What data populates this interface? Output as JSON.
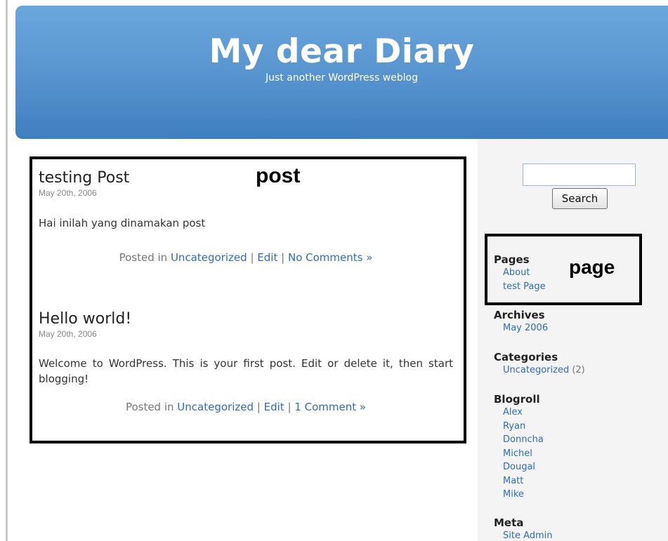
{
  "header": {
    "title": "My dear Diary",
    "tagline": "Just another WordPress weblog"
  },
  "annotations": {
    "post_label": "post",
    "page_label": "page"
  },
  "posts": [
    {
      "title": "testing Post",
      "date": "May 20th, 2006",
      "body": "Hai inilah yang dinamakan post",
      "posted_in": "Posted in",
      "category": "Uncategorized",
      "sep1": "|",
      "edit": "Edit",
      "sep2": "|",
      "comments": "No Comments »"
    },
    {
      "title": "Hello world!",
      "date": "May 20th, 2006",
      "body": "Welcome to WordPress. This is your first post. Edit or delete it, then start blogging!",
      "posted_in": "Posted in",
      "category": "Uncategorized",
      "sep1": "|",
      "edit": "Edit",
      "sep2": "|",
      "comments": "1 Comment »"
    }
  ],
  "search": {
    "value": "",
    "button_label": "Search"
  },
  "sidebar": {
    "pages": {
      "heading": "Pages",
      "items": [
        "About",
        "test Page"
      ]
    },
    "archives": {
      "heading": "Archives",
      "items": [
        "May 2006"
      ]
    },
    "categories": {
      "heading": "Categories",
      "items": [
        {
          "label": "Uncategorized",
          "count": "(2)"
        }
      ]
    },
    "blogroll": {
      "heading": "Blogroll",
      "items": [
        "Alex",
        "Ryan",
        "Donncha",
        "Michel",
        "Dougal",
        "Matt",
        "Mike"
      ]
    },
    "meta": {
      "heading": "Meta",
      "items": [
        "Site Admin"
      ]
    }
  },
  "colors": {
    "header_top": "#6aa7dc",
    "header_bottom": "#3f7ec0",
    "link": "#2f6bc0",
    "sidebar_bg": "#f4f4f4",
    "annotation_border": "#000000"
  }
}
